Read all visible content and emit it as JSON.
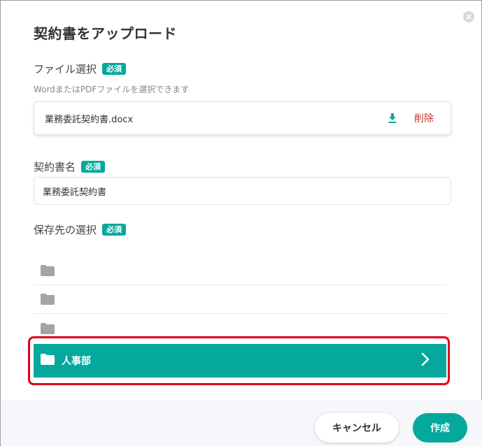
{
  "dialog": {
    "title": "契約書をアップロード"
  },
  "file_section": {
    "label": "ファイル選択",
    "badge": "必須",
    "hint": "WordまたはPDFファイルを選択できます",
    "file_name": "業務委託契約書.docx",
    "delete_label": "削除"
  },
  "name_section": {
    "label": "契約書名",
    "badge": "必須",
    "value": "業務委託契約書"
  },
  "destination_section": {
    "label": "保存先の選択",
    "badge": "必須",
    "folders": [
      {
        "label": ""
      },
      {
        "label": ""
      },
      {
        "label": ""
      }
    ],
    "selected_folder": "人事部"
  },
  "footer": {
    "cancel_label": "キャンセル",
    "create_label": "作成"
  },
  "colors": {
    "accent": "#05a89d",
    "danger": "#c0392b",
    "highlight": "#e0001b",
    "folder_grey": "#a0a4ab"
  },
  "icons": {
    "close": "close-icon",
    "download": "download-icon",
    "folder": "folder-icon",
    "chevron": "chevron-right-icon"
  }
}
